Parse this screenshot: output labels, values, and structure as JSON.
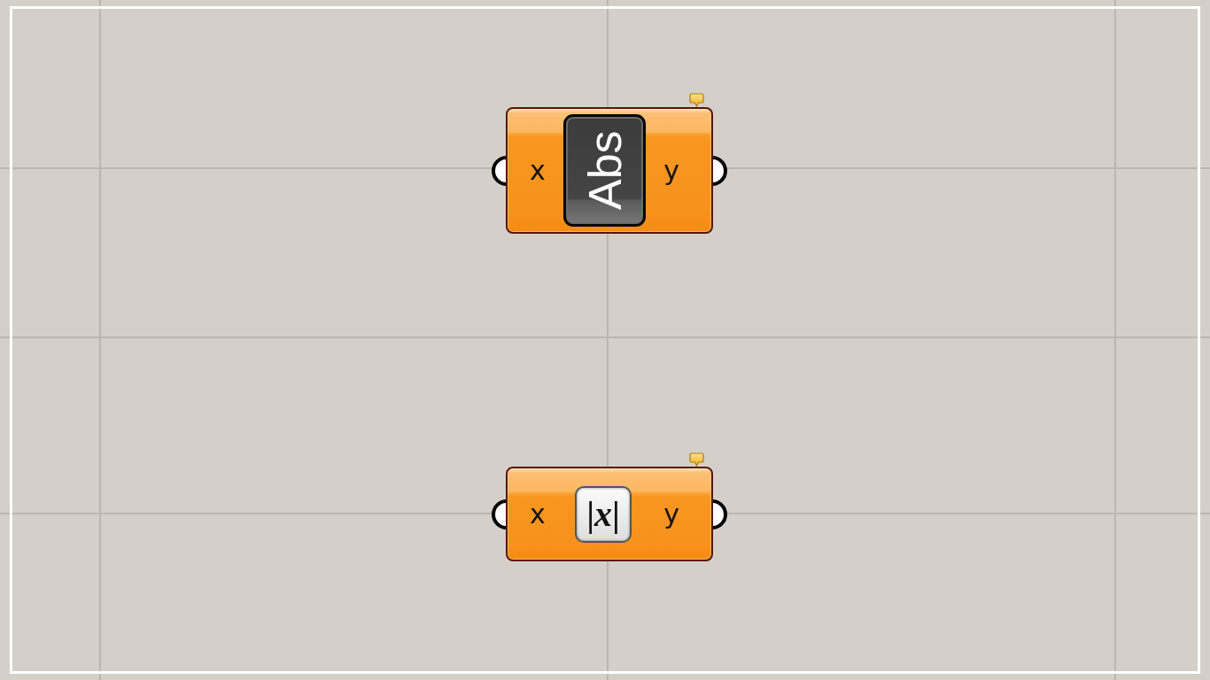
{
  "canvas": {
    "components": [
      {
        "kind": "text-label",
        "name": "Abs",
        "inputs": [
          "x"
        ],
        "outputs": [
          "y"
        ]
      },
      {
        "kind": "icon",
        "icon_glyph": "|*x*|",
        "inputs": [
          "x"
        ],
        "outputs": [
          "y"
        ]
      }
    ]
  }
}
